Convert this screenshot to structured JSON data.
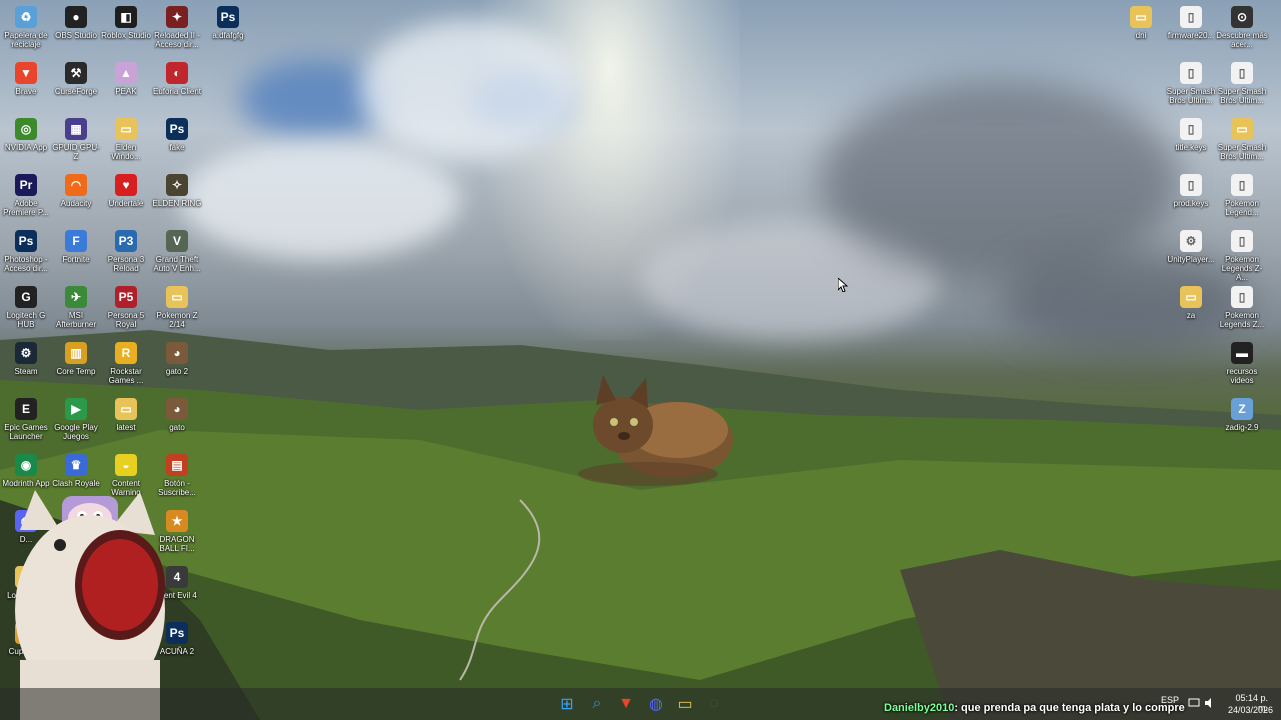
{
  "desktop": {
    "left_icons": [
      {
        "label": "Papelera de reciclaje",
        "icon": "recycle-bin-icon",
        "color": "#5aa0d8",
        "glyph": "♻"
      },
      {
        "label": "OBS Studio",
        "icon": "obs-icon",
        "color": "#222222",
        "glyph": "●"
      },
      {
        "label": "Roblox Studio",
        "icon": "roblox-studio-icon",
        "color": "#1e1e1e",
        "glyph": "◧"
      },
      {
        "label": "Reloaded II - Acceso dir...",
        "icon": "reloaded-icon",
        "color": "#7a2020",
        "glyph": "✦"
      },
      {
        "label": "a.dfafgfg",
        "icon": "photoshop-file-icon",
        "color": "#0b2f5a",
        "glyph": "Ps"
      },
      {
        "label": "Brave",
        "icon": "brave-icon",
        "color": "#e8452c",
        "glyph": "▼"
      },
      {
        "label": "CurseForge",
        "icon": "curseforge-icon",
        "color": "#2a2a2a",
        "glyph": "⚒"
      },
      {
        "label": "PEAK",
        "icon": "peak-icon",
        "color": "#c9a2d8",
        "glyph": "▲"
      },
      {
        "label": "Euforia Client",
        "icon": "euforia-icon",
        "color": "#c0272d",
        "glyph": "◐"
      },
      {
        "label": "NVIDIA App",
        "icon": "nvidia-icon",
        "color": "#3c8a2c",
        "glyph": "◎"
      },
      {
        "label": "GPUID GPU-Z",
        "icon": "gpuz-icon",
        "color": "#4a3f8c",
        "glyph": "▦"
      },
      {
        "label": "Elden Windo...",
        "icon": "folder-icon",
        "color": "#e8c35a",
        "glyph": "▭"
      },
      {
        "label": "fake",
        "icon": "photoshop-file-icon",
        "color": "#0b2f5a",
        "glyph": "Ps"
      },
      {
        "label": "Adobe Premiere P...",
        "icon": "premiere-icon",
        "color": "#1a1a5a",
        "glyph": "Pr"
      },
      {
        "label": "Audacity",
        "icon": "audacity-icon",
        "color": "#f06a1a",
        "glyph": "◠"
      },
      {
        "label": "Undertale",
        "icon": "undertale-icon",
        "color": "#d81e1e",
        "glyph": "♥"
      },
      {
        "label": "ELDEN RING",
        "icon": "elden-ring-icon",
        "color": "#4a4530",
        "glyph": "✧"
      },
      {
        "label": "Photoshop - Acceso dir...",
        "icon": "photoshop-icon",
        "color": "#0b2f5a",
        "glyph": "Ps"
      },
      {
        "label": "Fortnite",
        "icon": "fortnite-icon",
        "color": "#3a7ad8",
        "glyph": "F"
      },
      {
        "label": "Persona 3 Reload",
        "icon": "persona3-icon",
        "color": "#2a6ab0",
        "glyph": "P3"
      },
      {
        "label": "Grand Theft Auto V Enh...",
        "icon": "gta-icon",
        "color": "#556655",
        "glyph": "V"
      },
      {
        "label": "Logitech G HUB",
        "icon": "logitech-icon",
        "color": "#222222",
        "glyph": "G"
      },
      {
        "label": "MSI Afterburner",
        "icon": "afterburner-icon",
        "color": "#3a8a3a",
        "glyph": "✈"
      },
      {
        "label": "Persona 5 Royal",
        "icon": "persona5-icon",
        "color": "#b0202a",
        "glyph": "P5"
      },
      {
        "label": "Pokemon Z 2/14",
        "icon": "folder-icon",
        "color": "#e8c35a",
        "glyph": "▭"
      },
      {
        "label": "Steam",
        "icon": "steam-icon",
        "color": "#1b2838",
        "glyph": "⚙"
      },
      {
        "label": "Core Temp",
        "icon": "core-temp-icon",
        "color": "#d8a020",
        "glyph": "▥"
      },
      {
        "label": "Rockstar Games ...",
        "icon": "rockstar-icon",
        "color": "#e8b020",
        "glyph": "R"
      },
      {
        "label": "gato 2",
        "icon": "cat-image-icon",
        "color": "#7a5a3a",
        "glyph": "◕"
      },
      {
        "label": "Epic Games Launcher",
        "icon": "epic-games-icon",
        "color": "#222222",
        "glyph": "E"
      },
      {
        "label": "Google Play Juegos",
        "icon": "google-play-icon",
        "color": "#2a9a4a",
        "glyph": "▶"
      },
      {
        "label": "latest",
        "icon": "image-file-icon",
        "color": "#e8c35a",
        "glyph": "▭"
      },
      {
        "label": "gato",
        "icon": "cat-image-icon",
        "color": "#7a5a3a",
        "glyph": "◕"
      },
      {
        "label": "Modrinth App",
        "icon": "modrinth-icon",
        "color": "#1a8a4a",
        "glyph": "◉"
      },
      {
        "label": "Clash Royale",
        "icon": "clash-royale-icon",
        "color": "#3a6ad8",
        "glyph": "♛"
      },
      {
        "label": "Content Warning",
        "icon": "content-warning-icon",
        "color": "#e8d020",
        "glyph": "◒"
      },
      {
        "label": "Botón - Suscribe...",
        "icon": "subscribe-button-icon",
        "color": "#c04020",
        "glyph": "▤"
      },
      {
        "label": "D...",
        "icon": "discord-icon",
        "color": "#5865f2",
        "glyph": "◍"
      },
      {
        "label": "N...",
        "icon": "app-icon",
        "color": "#e8c35a",
        "glyph": "▭"
      },
      {
        "label": "DRAGON BALL FI...",
        "icon": "dragon-ball-icon",
        "color": "#d88a20",
        "glyph": "★"
      },
      {
        "label": "Loqueno...",
        "icon": "folder-icon",
        "color": "#e8c35a",
        "glyph": "▭"
      },
      {
        "label": "...ent Evil 4",
        "icon": "resident-evil-icon",
        "color": "#3a3a3a",
        "glyph": "4"
      },
      {
        "label": "Cuphea...",
        "icon": "cuphead-icon",
        "color": "#d8a030",
        "glyph": "☕"
      },
      {
        "label": "ACUÑA 2",
        "icon": "photoshop-file-icon",
        "color": "#0b2f5a",
        "glyph": "Ps"
      }
    ],
    "right_icons": [
      {
        "label": "dni",
        "icon": "folder-icon",
        "color": "#e8c35a",
        "glyph": "▭"
      },
      {
        "label": "firmware20...",
        "icon": "file-icon",
        "color": "#f2f2f2",
        "glyph": "▯"
      },
      {
        "label": "Descubre más acer...",
        "icon": "discover-icon",
        "color": "#333333",
        "glyph": "⊙"
      },
      {
        "label": "Super Smash Bros Ultim...",
        "icon": "file-icon",
        "color": "#f2f2f2",
        "glyph": "▯"
      },
      {
        "label": "Super Smash Bros Ultim...",
        "icon": "file-icon",
        "color": "#f2f2f2",
        "glyph": "▯"
      },
      {
        "label": "title.keys",
        "icon": "file-icon",
        "color": "#f2f2f2",
        "glyph": "▯"
      },
      {
        "label": "Super Smash Bros Ultim...",
        "icon": "folder-icon",
        "color": "#e8c35a",
        "glyph": "▭"
      },
      {
        "label": "prod.keys",
        "icon": "file-icon",
        "color": "#f2f2f2",
        "glyph": "▯"
      },
      {
        "label": "Pokemon Legend...",
        "icon": "file-icon",
        "color": "#f2f2f2",
        "glyph": "▯"
      },
      {
        "label": "UnityPlayer...",
        "icon": "dll-file-icon",
        "color": "#f2f2f2",
        "glyph": "⚙"
      },
      {
        "label": "Pokemon Legends Z-A...",
        "icon": "file-icon",
        "color": "#f2f2f2",
        "glyph": "▯"
      },
      {
        "label": "za",
        "icon": "folder-icon",
        "color": "#e8c35a",
        "glyph": "▭"
      },
      {
        "label": "Pokemon Legends Z...",
        "icon": "file-icon",
        "color": "#f2f2f2",
        "glyph": "▯"
      },
      {
        "label": "recursos videos",
        "icon": "folder-icon",
        "color": "#222222",
        "glyph": "▬"
      },
      {
        "label": "zadig-2.9",
        "icon": "zadig-icon",
        "color": "#6aa0d8",
        "glyph": "Z"
      }
    ]
  },
  "taskbar": {
    "apps": [
      {
        "name": "start-button",
        "icon": "windows-icon",
        "glyph": "⊞",
        "color": "#3aa0f0"
      },
      {
        "name": "search-button",
        "icon": "search-icon",
        "glyph": "⌕",
        "color": "#3a8ad8"
      },
      {
        "name": "brave-taskbar-button",
        "icon": "brave-icon",
        "glyph": "▼",
        "color": "#e8452c"
      },
      {
        "name": "discord-taskbar-button",
        "icon": "discord-icon",
        "glyph": "◍",
        "color": "#5865f2"
      },
      {
        "name": "file-explorer-button",
        "icon": "folder-icon",
        "glyph": "▭",
        "color": "#e8c35a"
      },
      {
        "name": "settings-taskbar-button",
        "icon": "app-icon",
        "glyph": "◌",
        "color": "#555555"
      }
    ],
    "language": "ESP",
    "time": "05:14 p. m.",
    "date": "24/03/2026"
  },
  "chat_overlay": {
    "user": "Danielby2010",
    "message": ": que prenda pa que tenga plata y lo compre"
  }
}
